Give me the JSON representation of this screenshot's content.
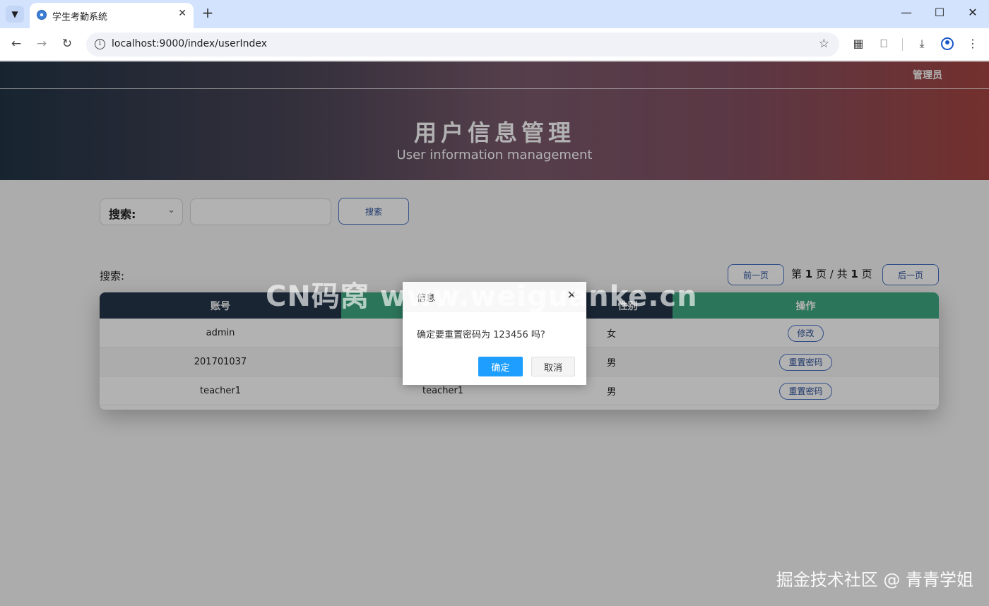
{
  "browser": {
    "tab_title": "学生考勤系统",
    "url": "localhost:9000/index/userIndex",
    "icons": {
      "tab_menu": "chevron-down-icon",
      "close_tab": "close-icon",
      "new_tab": "plus-icon",
      "back": "arrow-left-icon",
      "forward": "arrow-right-icon",
      "reload": "reload-icon",
      "site_info": "info-icon",
      "bookmark": "star-icon",
      "screenshot": "crop-icon",
      "extensions": "puzzle-icon",
      "download": "download-icon",
      "profile": "profile-icon",
      "more": "more-vertical-icon"
    },
    "colors": {
      "tabbar": "#d3e3fd",
      "toolbar": "#ffffff"
    }
  },
  "header": {
    "user": "管理员",
    "title": "用户信息管理",
    "subtitle": "User information management"
  },
  "search": {
    "select_label": "搜索:",
    "input_value": "",
    "button_label": "搜索"
  },
  "list": {
    "label": "搜索:",
    "prev_label": "前一页",
    "next_label": "后一页",
    "page_prefix": "第",
    "page_current": "1",
    "page_middle": "页 / 共",
    "page_total": "1",
    "page_suffix": "页"
  },
  "table": {
    "columns": [
      "账号",
      "",
      "性别",
      "操作"
    ],
    "header_colors": [
      "#24354a",
      "#3ea882",
      "#24354a",
      "#3ea882"
    ],
    "rows": [
      {
        "account": "admin",
        "name": "",
        "gender": "女",
        "action": "修改"
      },
      {
        "account": "201701037",
        "name": "",
        "gender": "男",
        "action": "重置密码"
      },
      {
        "account": "teacher1",
        "name": "teacher1",
        "gender": "男",
        "action": "重置密码"
      }
    ]
  },
  "dialog": {
    "title": "信息",
    "message": "确定要重置密码为 123456 吗?",
    "ok_label": "确定",
    "cancel_label": "取消",
    "ok_color": "#1e9fff"
  },
  "watermarks": {
    "center": "CN码窝 www.weiguanke.cn",
    "corner": "掘金技术社区 @ 青青学姐"
  }
}
